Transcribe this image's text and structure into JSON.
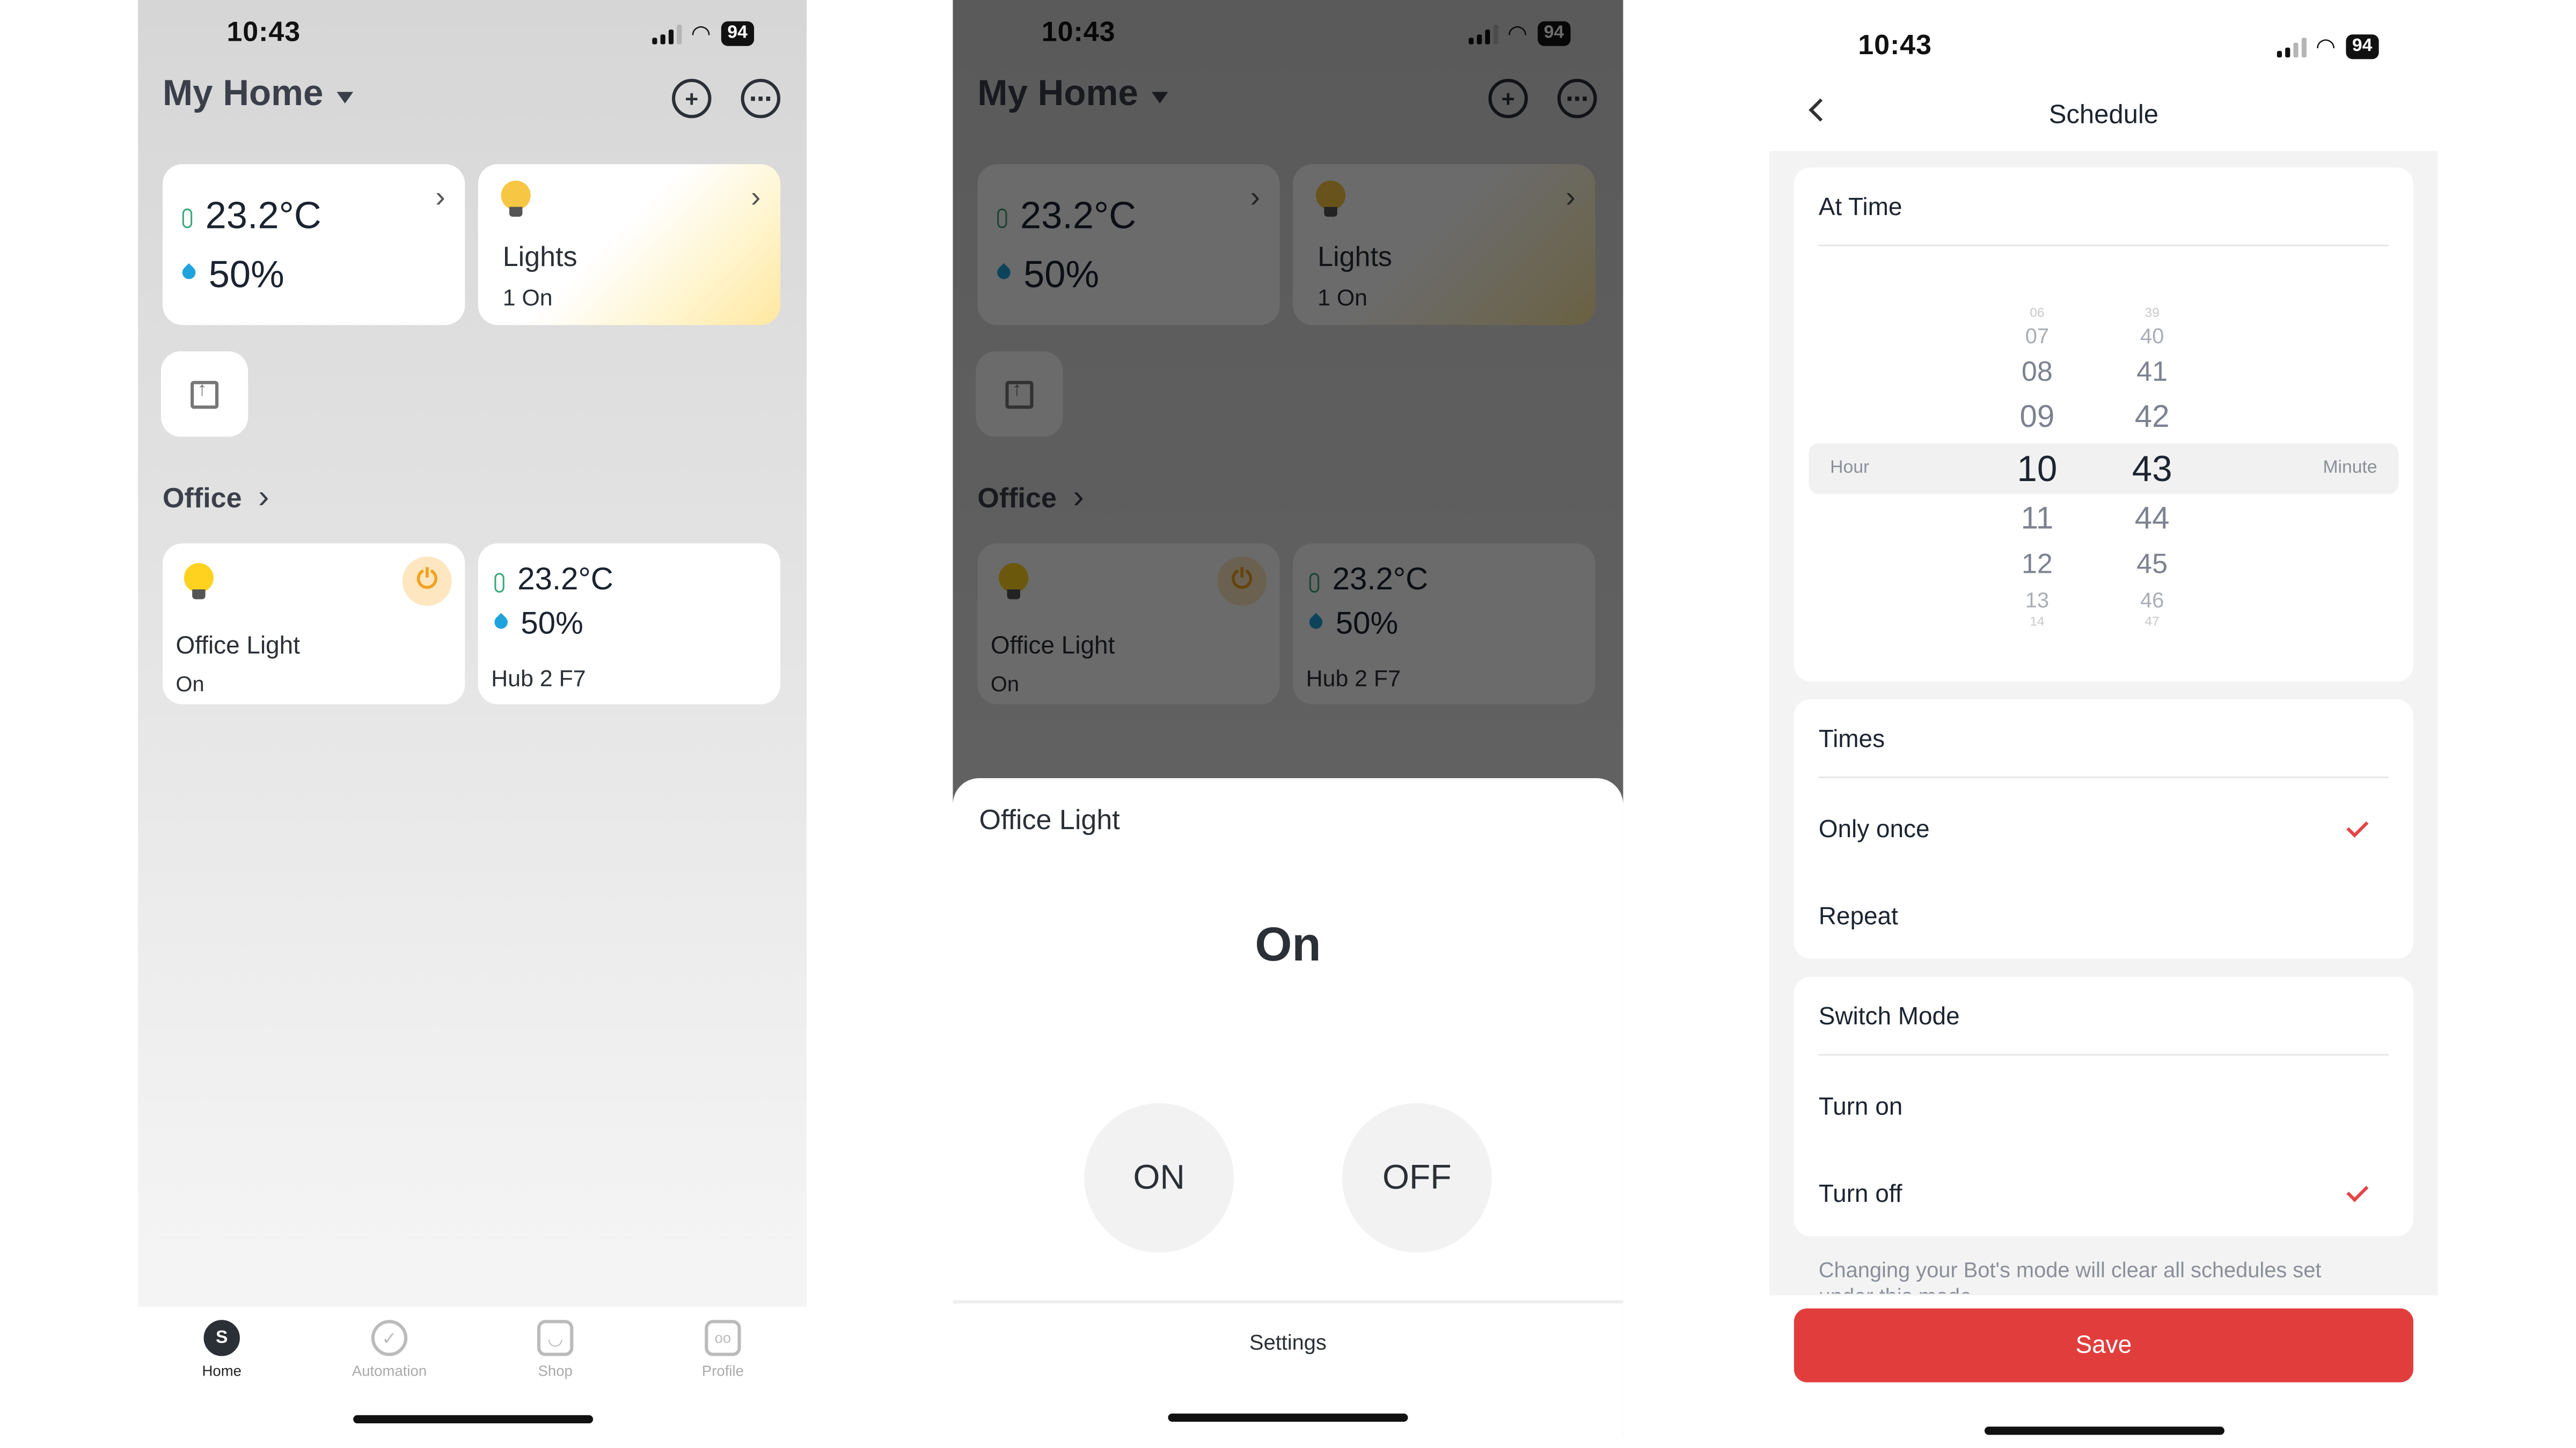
{
  "status_bar": {
    "time": "10:43",
    "battery": "94"
  },
  "home_screen": {
    "title": "My Home",
    "climate_card": {
      "temperature": "23.2°C",
      "humidity": "50%"
    },
    "lights_card": {
      "title": "Lights",
      "status": "1 On"
    },
    "section_title": "Office",
    "office_light": {
      "name": "Office Light",
      "state": "On"
    },
    "hub_card": {
      "temperature": "23.2°C",
      "humidity": "50%",
      "name": "Hub 2 F7"
    },
    "tabs": [
      {
        "label": "Home",
        "icon": "home-s-icon",
        "glyph": "S"
      },
      {
        "label": "Automation",
        "icon": "automation-icon",
        "glyph": "✓"
      },
      {
        "label": "Shop",
        "icon": "shop-icon",
        "glyph": "◡"
      },
      {
        "label": "Profile",
        "icon": "profile-robot-icon",
        "glyph": "oo"
      }
    ]
  },
  "sheet": {
    "title": "Office Light",
    "state": "On",
    "on_label": "ON",
    "off_label": "OFF",
    "settings_label": "Settings"
  },
  "schedule": {
    "title": "Schedule",
    "at_time_label": "At Time",
    "hour_label": "Hour",
    "minute_label": "Minute",
    "hours": [
      "06",
      "07",
      "08",
      "09",
      "10",
      "11",
      "12",
      "13",
      "14"
    ],
    "minutes": [
      "39",
      "40",
      "41",
      "42",
      "43",
      "44",
      "45",
      "46",
      "47"
    ],
    "selected_hour": "10",
    "selected_minute": "43",
    "times_label": "Times",
    "times_options": [
      "Only once",
      "Repeat"
    ],
    "times_selected": "Only once",
    "switch_mode_label": "Switch Mode",
    "switch_options": [
      "Turn on",
      "Turn off"
    ],
    "switch_selected": "Turn off",
    "hint": "Changing your Bot's mode will clear all schedules set under this mode.",
    "save_label": "Save"
  },
  "colors": {
    "accent_red": "#e23d3d",
    "check_red": "#e54545",
    "bulb_yellow": "#ffd21f",
    "humidity_blue": "#1fa3dc",
    "temp_green": "#3aa77a"
  }
}
